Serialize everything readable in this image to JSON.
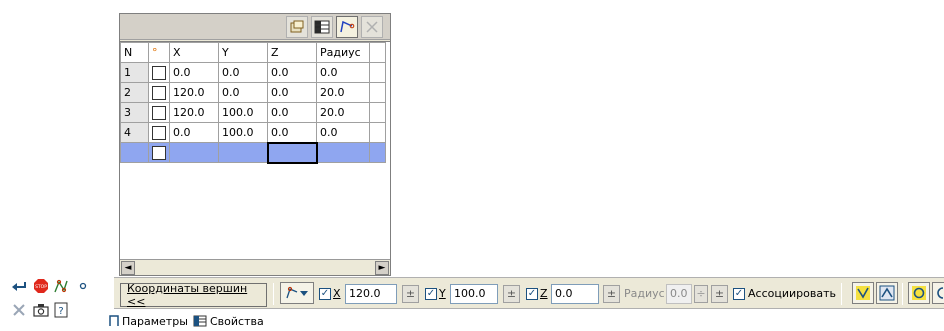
{
  "table": {
    "columns": [
      "N",
      "°",
      "X",
      "Y",
      "Z",
      "Радиус"
    ],
    "rows": [
      {
        "n": "1",
        "x": "0.0",
        "y": "0.0",
        "z": "0.0",
        "r": "0.0"
      },
      {
        "n": "2",
        "x": "120.0",
        "y": "0.0",
        "z": "0.0",
        "r": "20.0"
      },
      {
        "n": "3",
        "x": "120.0",
        "y": "100.0",
        "z": "0.0",
        "r": "20.0"
      },
      {
        "n": "4",
        "x": "0.0",
        "y": "100.0",
        "z": "0.0",
        "r": "0.0"
      }
    ],
    "scroll_left": "◄",
    "scroll_right": "►"
  },
  "propbar": {
    "coords_button": "Координаты вершин  <<",
    "x_label": "X",
    "x_value": "120.0",
    "y_label": "Y",
    "y_value": "100.0",
    "z_label": "Z",
    "z_value": "0.0",
    "radius_label": "Радиус",
    "radius_value": "0.0",
    "associate_label": "Ассоциировать",
    "plus_glyph": "±"
  },
  "tabs": {
    "params": "Параметры",
    "props": "Свойства"
  },
  "colors": {
    "selected_row": "#8fa6f0",
    "panel_bg": "#ece9d8",
    "stop": "#e0281c",
    "accent_blue": "#1c5180"
  },
  "icons": [
    "copy-icon",
    "table-icon",
    "vertex-icon",
    "close-icon",
    "enter-icon",
    "stop-icon",
    "graph-icon",
    "point-icon",
    "pin-icon",
    "camera-icon",
    "help-icon",
    "select-icon",
    "rotate-icon"
  ]
}
